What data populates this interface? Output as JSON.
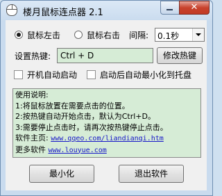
{
  "window": {
    "title": "楼月鼠标连点器 2.1",
    "close_glyph": "✕"
  },
  "mode": {
    "left_label": "鼠标左击",
    "right_label": "鼠标右击",
    "selected": "left"
  },
  "interval": {
    "label": "间隔:",
    "value": "0.1秒"
  },
  "hotkey": {
    "label": "设置热键:",
    "value": "Ctrl + D",
    "modify_button": "修改热键"
  },
  "options": {
    "autostart_label": "开机自动启动",
    "autostart_checked": false,
    "minimize_tray_label": "启动后自动最小化到托盘",
    "minimize_tray_checked": false
  },
  "instructions": {
    "heading": "使用说明:",
    "lines": [
      "1:将鼠标放置在需要点击的位置。",
      "2:按热键自动开始点击，默认为Ctrl+D。",
      "3:需要停止点击时，请再次按热键停止点击。"
    ],
    "homepage_label": "软件主页:",
    "homepage_url": "www.qqeo.com/liandianqi.htm",
    "more_label": "更多软件",
    "more_url": "www.louyue.com"
  },
  "buttons": {
    "minimize": "最小化",
    "exit": "退出软件"
  }
}
